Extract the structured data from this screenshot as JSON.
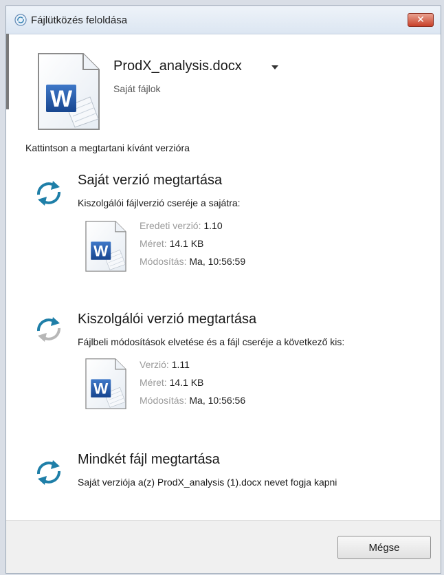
{
  "window": {
    "title": "Fájlütközés feloldása",
    "close_glyph": "✕"
  },
  "file": {
    "name": "ProdX_analysis.docx",
    "location": "Saját fájlok"
  },
  "instruction": "Kattintson a megtartani kívánt verzióra",
  "options": [
    {
      "title": "Saját verzió megtartása",
      "description": "Kiszolgálói fájlverzió cseréje a sajátra:",
      "icon": "sync-icon",
      "icon_style": "active",
      "meta": [
        {
          "label": "Eredeti verzió:",
          "value": "1.10"
        },
        {
          "label": "Méret:",
          "value": "14.1 KB"
        },
        {
          "label": "Módosítás:",
          "value": "Ma, 10:56:59"
        }
      ]
    },
    {
      "title": "Kiszolgálói verzió megtartása",
      "description": "Fájlbeli módosítások elvetése és a fájl cseréje a következő kis:",
      "icon": "sync-icon",
      "icon_style": "mixed",
      "meta": [
        {
          "label": "Verzió:",
          "value": "1.11"
        },
        {
          "label": "Méret:",
          "value": "14.1 KB"
        },
        {
          "label": "Módosítás:",
          "value": "Ma, 10:56:56"
        }
      ]
    },
    {
      "title": "Mindkét fájl megtartása",
      "description": "Saját verziója a(z) ProdX_analysis (1).docx nevet fogja kapni",
      "icon": "sync-icon",
      "icon_style": "active"
    }
  ],
  "footer": {
    "cancel_label": "Mégse"
  },
  "colors": {
    "accent": "#1f7fa8",
    "word_blue": "#1e4fa3",
    "muted_label": "#9a9a9a"
  }
}
